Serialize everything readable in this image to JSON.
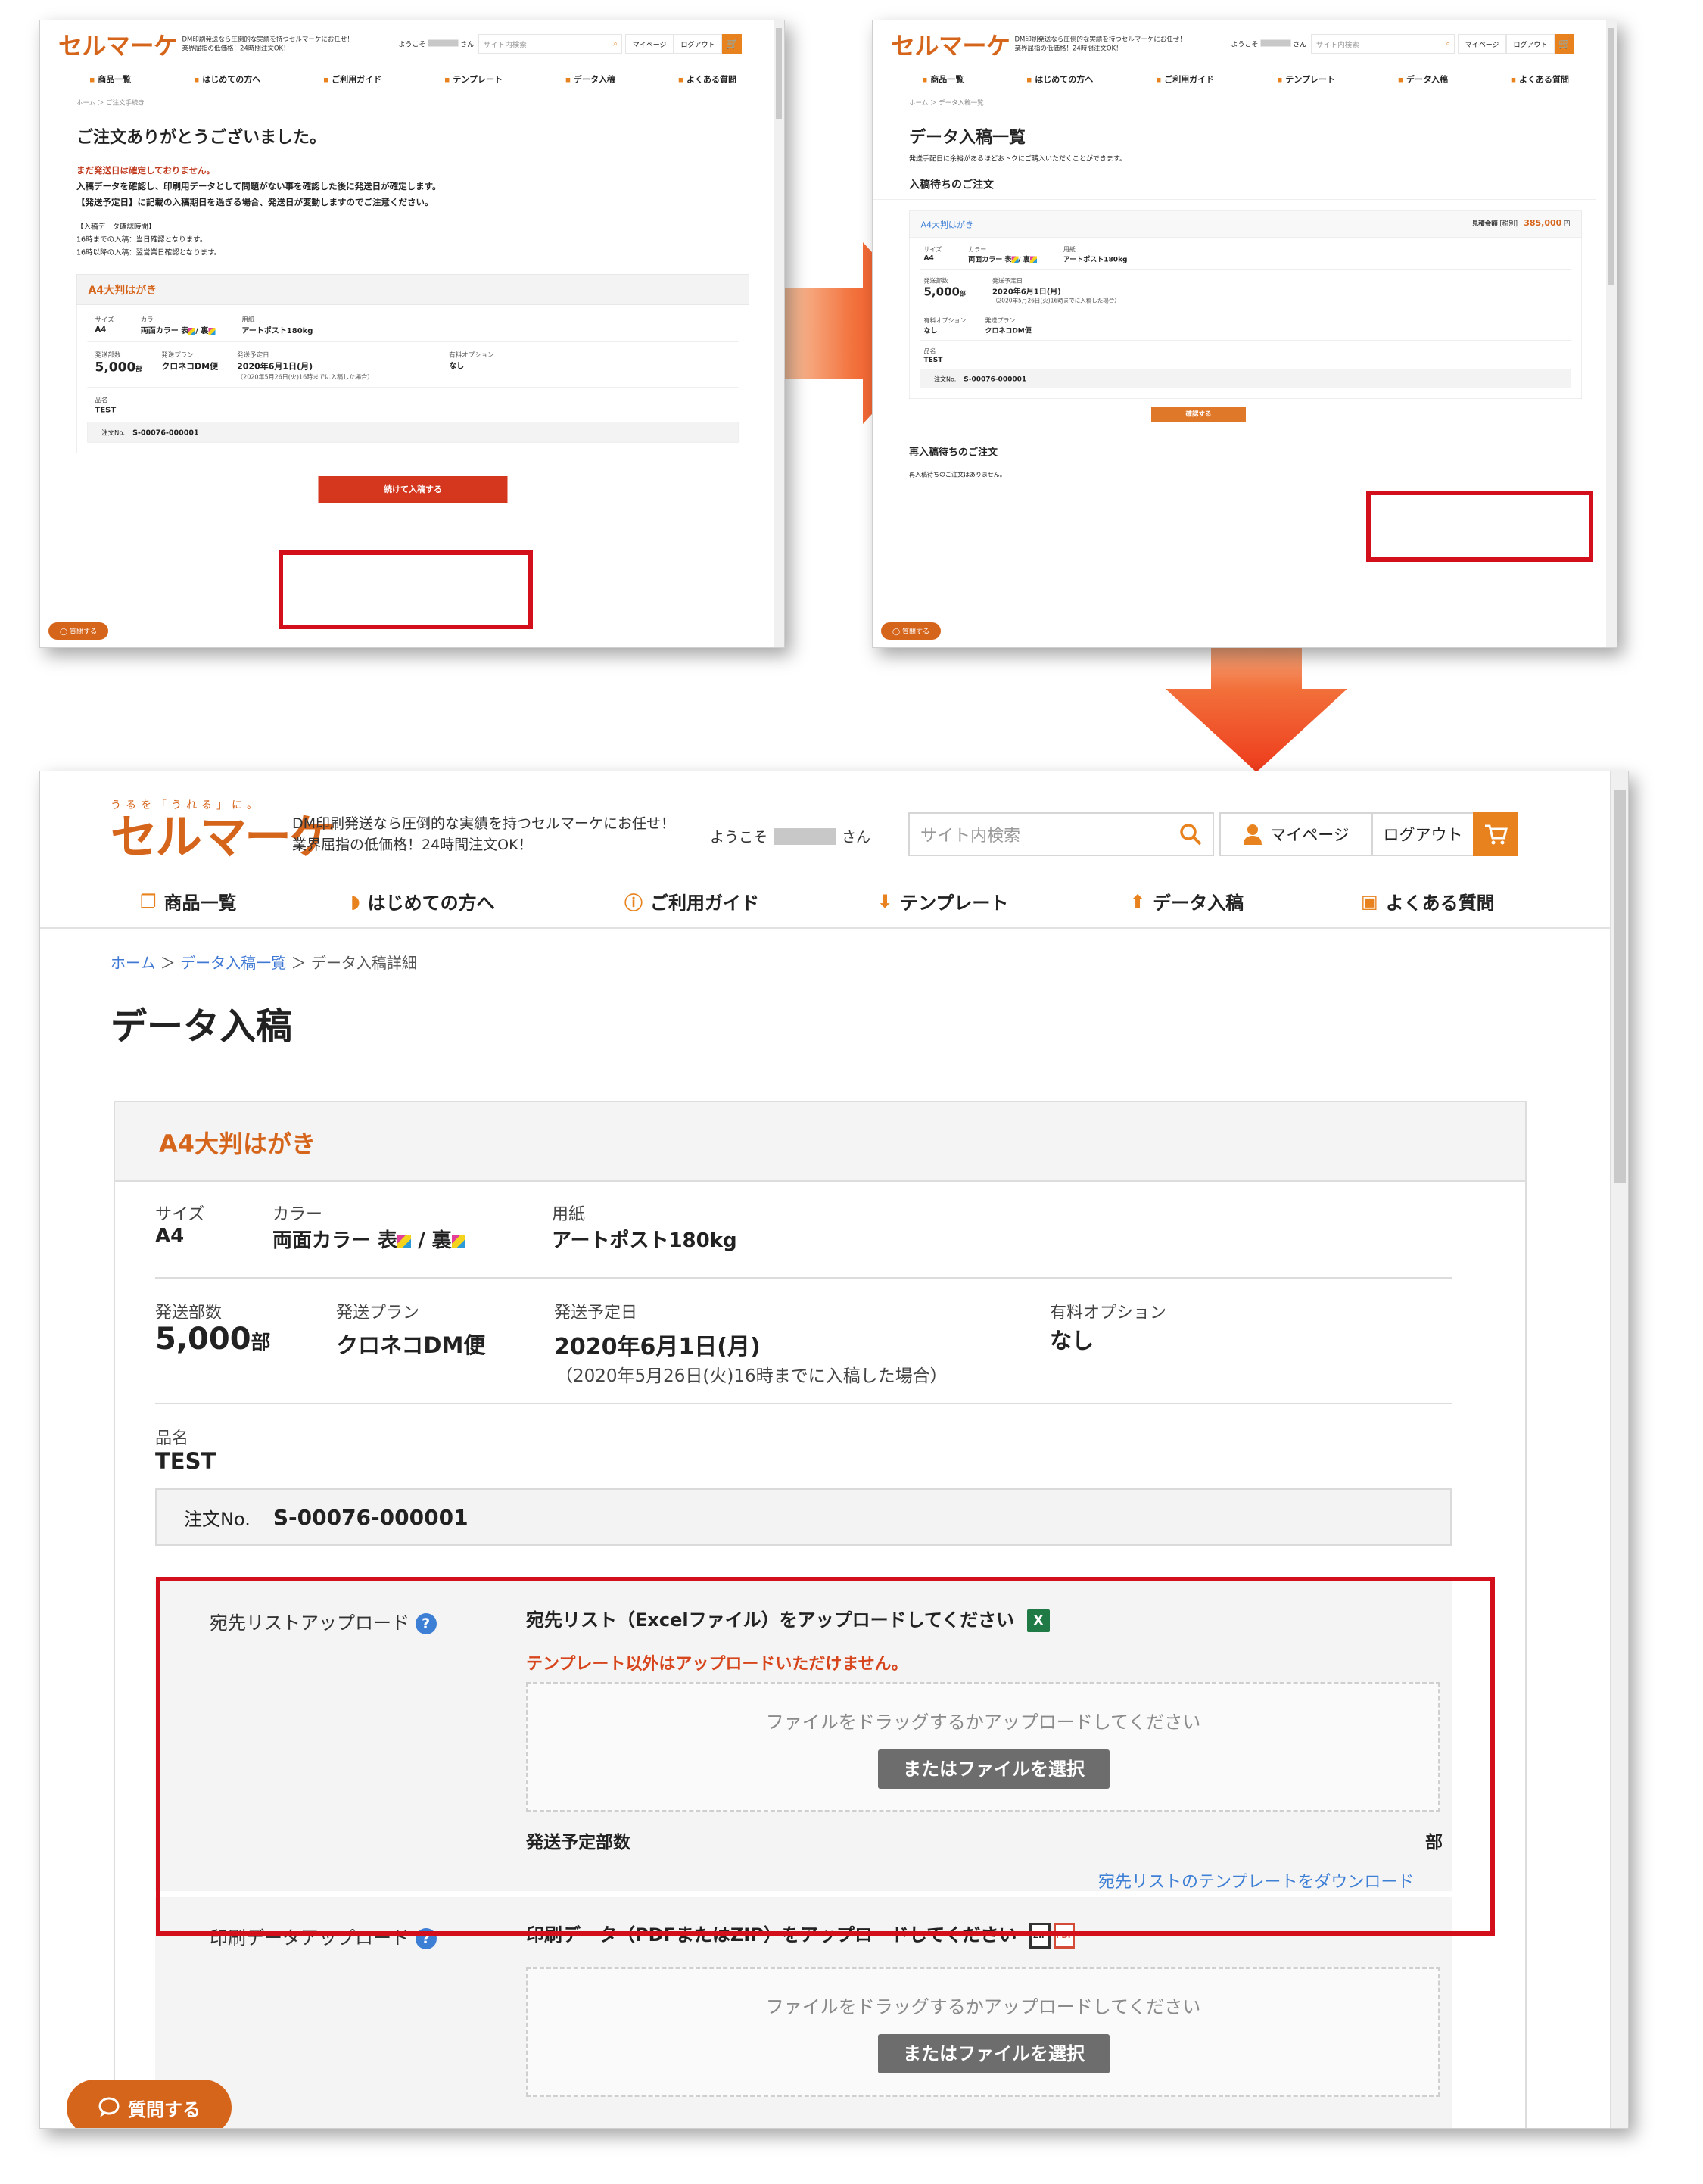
{
  "colors": {
    "accent": "#e8821e",
    "brand": "#d6651c",
    "highlight": "#d40f1c",
    "link": "#3e7fd6",
    "cta": "#d4371e",
    "arrow": "#f04a1a"
  },
  "header": {
    "logo_sub": "うるを「うれる」に。",
    "logo": "セルマーケ",
    "tagline_1": "DM印刷発送なら圧倒的な実績を持つセルマーケにお任せ！",
    "tagline_2": "業界屈指の低価格！24時間注文OK！",
    "welcome_prefix": "ようこそ",
    "welcome_suffix": "さん",
    "search_placeholder": "サイト内検索",
    "mypage": "マイページ",
    "logout": "ログアウト"
  },
  "nav": [
    "商品一覧",
    "はじめての方へ",
    "ご利用ガイド",
    "テンプレート",
    "データ入稿",
    "よくある質問"
  ],
  "chat_label": "質問する",
  "screen1": {
    "breadcrumb": "ホーム ＞ ご注文手続き",
    "title": "ご注文ありがとうございました。",
    "notice_red": "まだ発送日は確定しておりません。",
    "notice_1": "入稿データを確認し、印刷用データとして問題がない事を確認した後に発送日が確定します。",
    "notice_2": "【発送予定日】に記載の入稿期日を過ぎる場合、発送日が変動しますのでご注意ください。",
    "check_title": "【入稿データ確認時間】",
    "check_1": "16時までの入稿：当日確認となります。",
    "check_2": "16時以降の入稿：翌営業日確認となります。",
    "continue_button": "続けて入稿する"
  },
  "screen2": {
    "breadcrumb": "ホーム ＞ データ入稿一覧",
    "title": "データ入稿一覧",
    "lead": "発送手配日に余裕があるほどおトクにご購入いただくことができます。",
    "section_waiting": "入稿待ちのご注文",
    "quote_label": "見積金額",
    "tax_label": "[税別]",
    "quote_amount": "385,000",
    "yen": "円",
    "confirm_button": "確認する",
    "section_reupload": "再入稿待ちのご注文",
    "reupload_empty": "再入稿待ちのご注文はありません。"
  },
  "screen3": {
    "breadcrumb_home": "ホーム",
    "breadcrumb_list": "データ入稿一覧",
    "breadcrumb_current": "データ入稿詳細",
    "sep": "＞",
    "title": "データ入稿"
  },
  "order": {
    "product": "A4大判はがき",
    "size_label": "サイズ",
    "size": "A4",
    "color_label": "カラー",
    "color_text": "両面カラー 表",
    "color_slash": "/ 裏",
    "paper_label": "用紙",
    "paper": "アートポスト180kg",
    "qty_label": "発送部数",
    "qty": "5,000",
    "qty_unit": "部",
    "plan_label": "発送プラン",
    "plan": "クロネコDM便",
    "date_label": "発送予定日",
    "date": "2020年6月1日(月)",
    "date_note": "（2020年5月26日(火)16時までに入稿した場合）",
    "option_label": "有料オプション",
    "option": "なし",
    "item_label": "品名",
    "item": "TEST",
    "order_no_label": "注文No.",
    "order_no": "S-00076-000001"
  },
  "upload_list": {
    "label": "宛先リストアップロード",
    "instruction": "宛先リスト（Excelファイル）をアップロードしてください",
    "warning": "テンプレート以外はアップロードいただけません。",
    "drop_text": "ファイルをドラッグするかアップロードしてください",
    "select_button": "またはファイルを選択",
    "planned_qty_label": "発送予定部数",
    "planned_qty_unit": "部",
    "template_link": "宛先リストのテンプレートをダウンロード",
    "excel_icon": "X"
  },
  "upload_print": {
    "label": "印刷データアップロード",
    "instruction": "印刷データ（PDFまたはZIP）をアップロードしてください",
    "drop_text": "ファイルをドラッグするかアップロードしてください",
    "select_button": "またはファイルを選択",
    "zip_icon": "ZIP",
    "pdf_icon": "PDF"
  }
}
